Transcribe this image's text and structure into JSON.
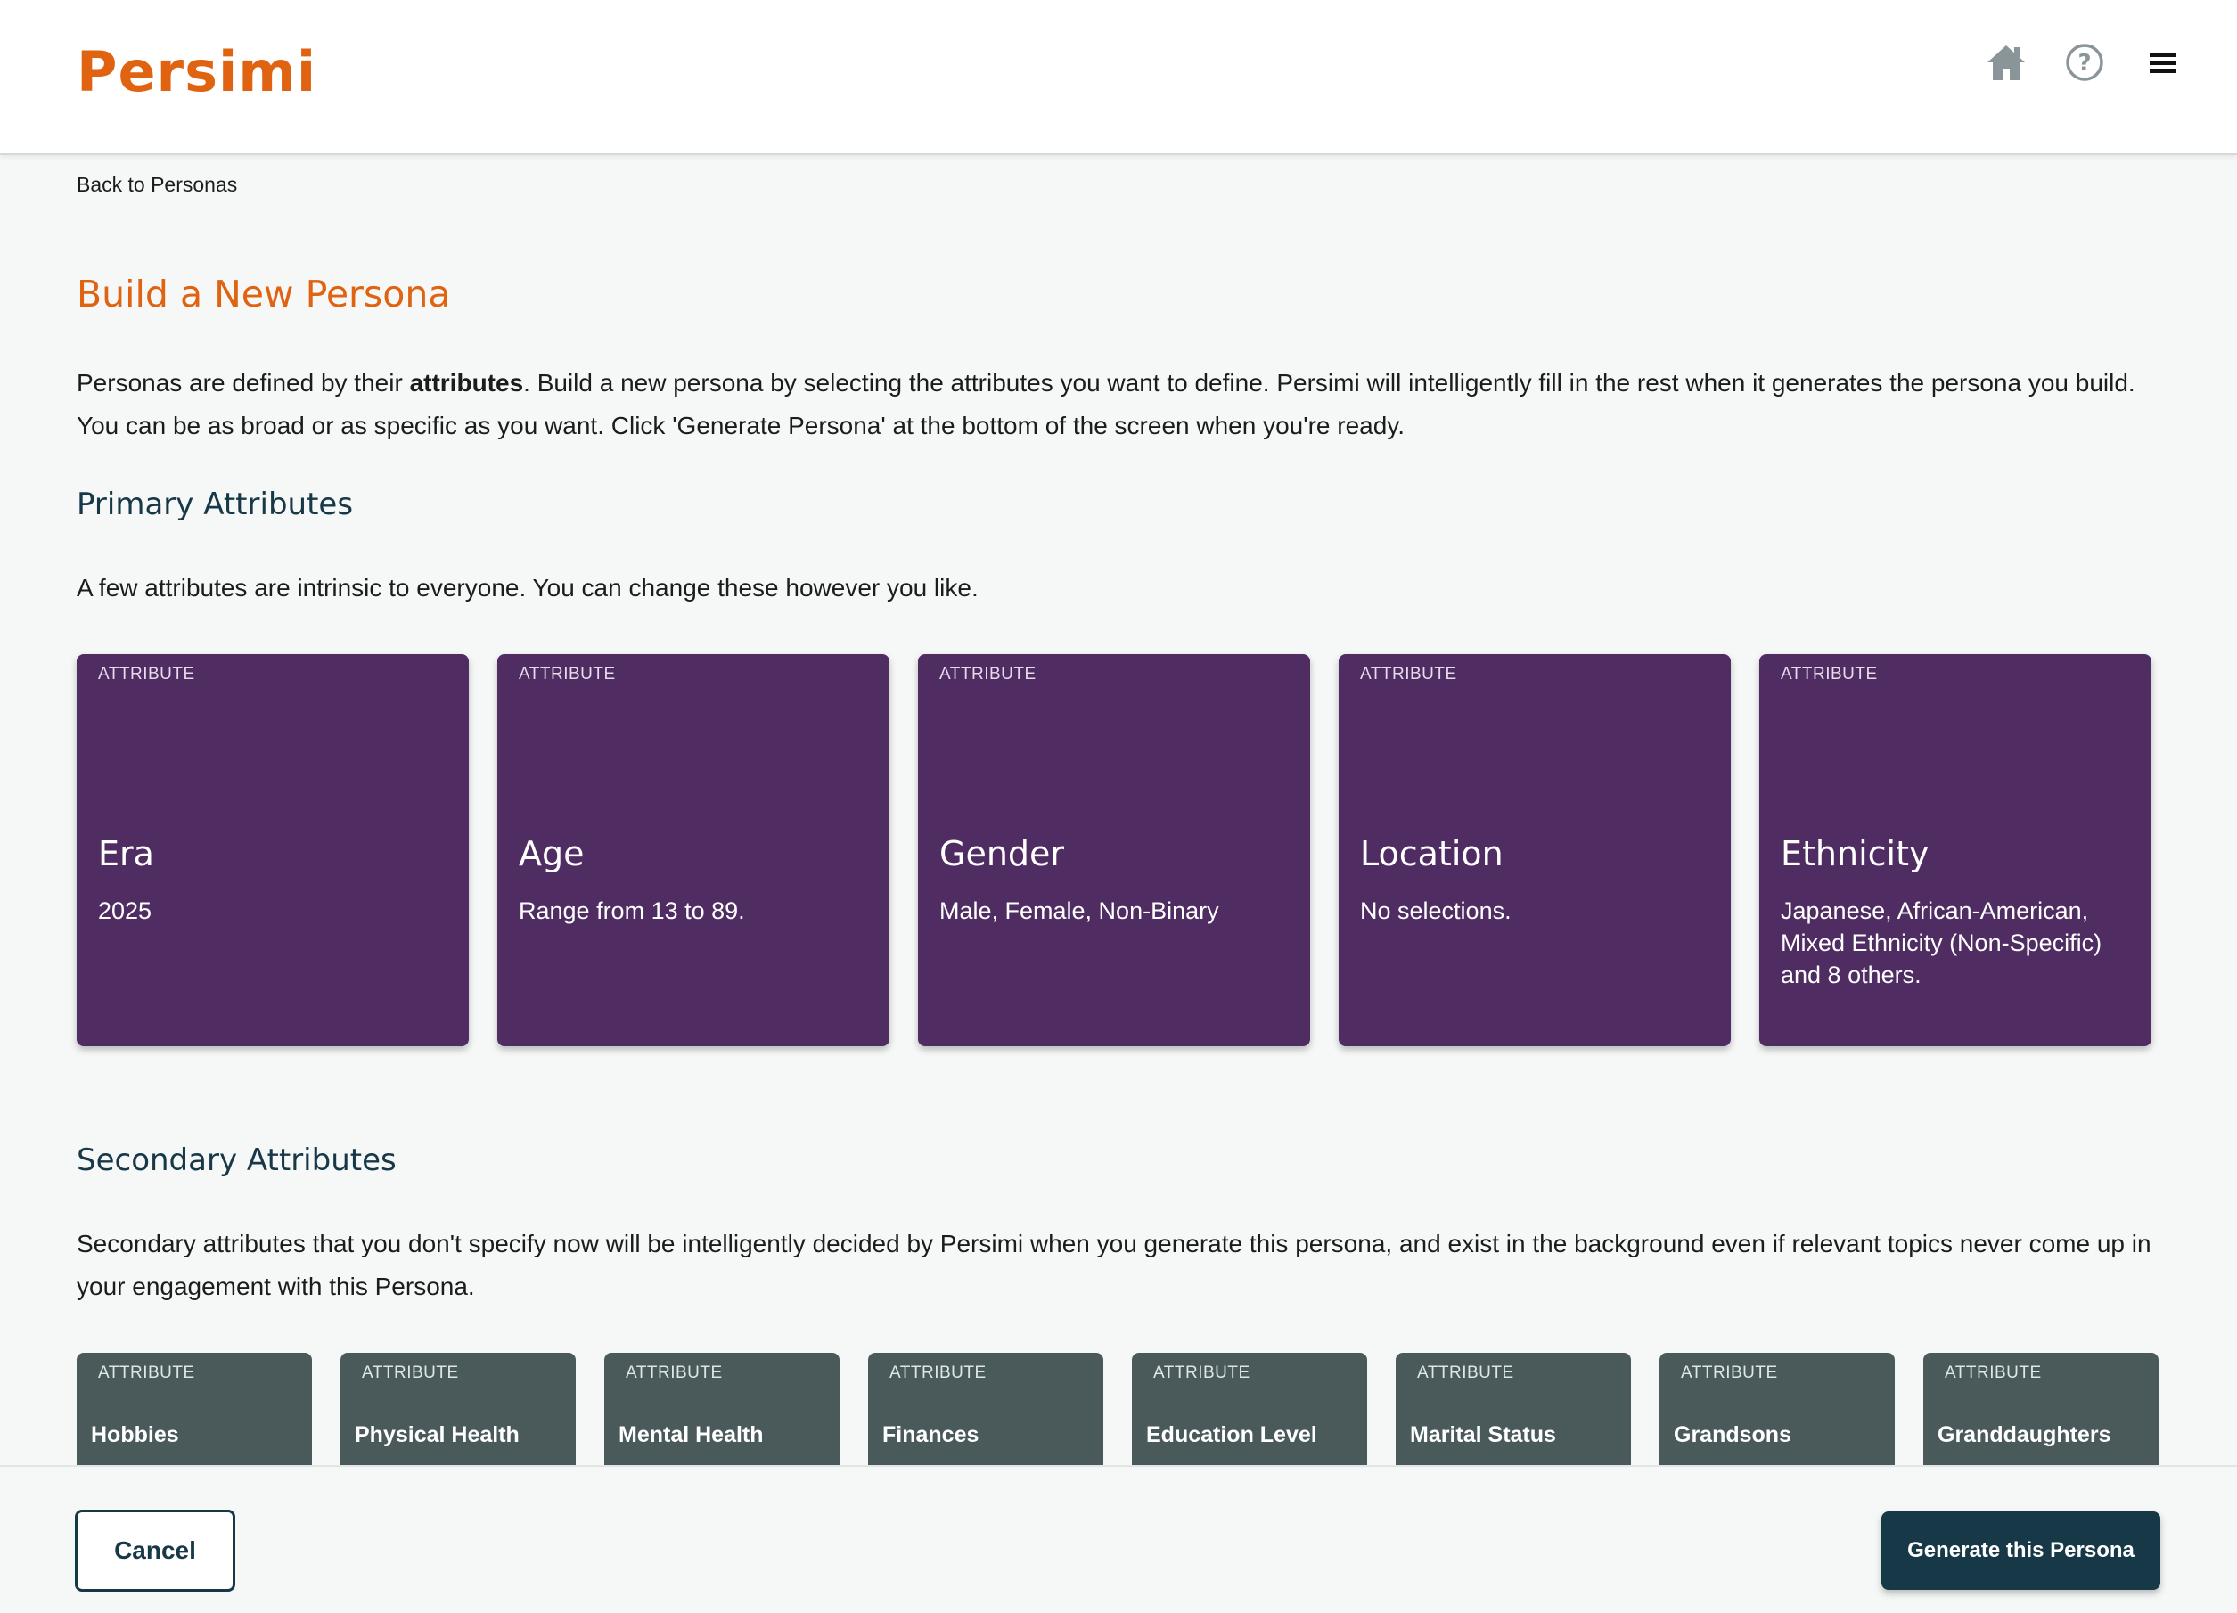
{
  "app": {
    "logo": "Persimi"
  },
  "header": {
    "icons": [
      "home-icon",
      "help-icon",
      "menu-icon"
    ],
    "icon_color": "#8a9599"
  },
  "nav": {
    "back_label": "Back to Personas"
  },
  "page": {
    "title": "Build a New Persona",
    "intro_pre": "Personas are defined by their ",
    "intro_bold": "attributes",
    "intro_post": ". Build a new persona by selecting the attributes you want to define. Persimi will intelligently fill in the rest when it generates the persona you build. You can be as broad or as specific as you want. Click 'Generate Persona' at the bottom of the screen when you're ready."
  },
  "primary": {
    "title": "Primary Attributes",
    "description": "A few attributes are intrinsic to everyone. You can change these however you like.",
    "cards": [
      {
        "tag": "ATTRIBUTE",
        "name": "Era",
        "value": "2025"
      },
      {
        "tag": "ATTRIBUTE",
        "name": "Age",
        "value": "Range from 13 to 89."
      },
      {
        "tag": "ATTRIBUTE",
        "name": "Gender",
        "value": "Male, Female, Non-Binary"
      },
      {
        "tag": "ATTRIBUTE",
        "name": "Location",
        "value": "No selections."
      },
      {
        "tag": "ATTRIBUTE",
        "name": "Ethnicity",
        "value": "Japanese, African-American, Mixed Ethnicity (Non-Specific) and 8 others."
      }
    ]
  },
  "secondary": {
    "title": "Secondary Attributes",
    "description": "Secondary attributes that you don't specify now will be intelligently decided by Persimi when you generate this persona, and exist in the background even if relevant topics never come up in your engagement with this Persona.",
    "cards": [
      {
        "tag": "ATTRIBUTE",
        "name": "Hobbies"
      },
      {
        "tag": "ATTRIBUTE",
        "name": "Physical Health"
      },
      {
        "tag": "ATTRIBUTE",
        "name": "Mental Health"
      },
      {
        "tag": "ATTRIBUTE",
        "name": "Finances"
      },
      {
        "tag": "ATTRIBUTE",
        "name": "Education Level"
      },
      {
        "tag": "ATTRIBUTE",
        "name": "Marital Status"
      },
      {
        "tag": "ATTRIBUTE",
        "name": "Grandsons"
      },
      {
        "tag": "ATTRIBUTE",
        "name": "Granddaughters"
      }
    ]
  },
  "footer": {
    "cancel_label": "Cancel",
    "generate_label": "Generate this Persona"
  },
  "colors": {
    "brand": "#e06312",
    "primary_card": "#4f2c61",
    "secondary_card": "#4a5a5b",
    "dark_button": "#173847"
  }
}
